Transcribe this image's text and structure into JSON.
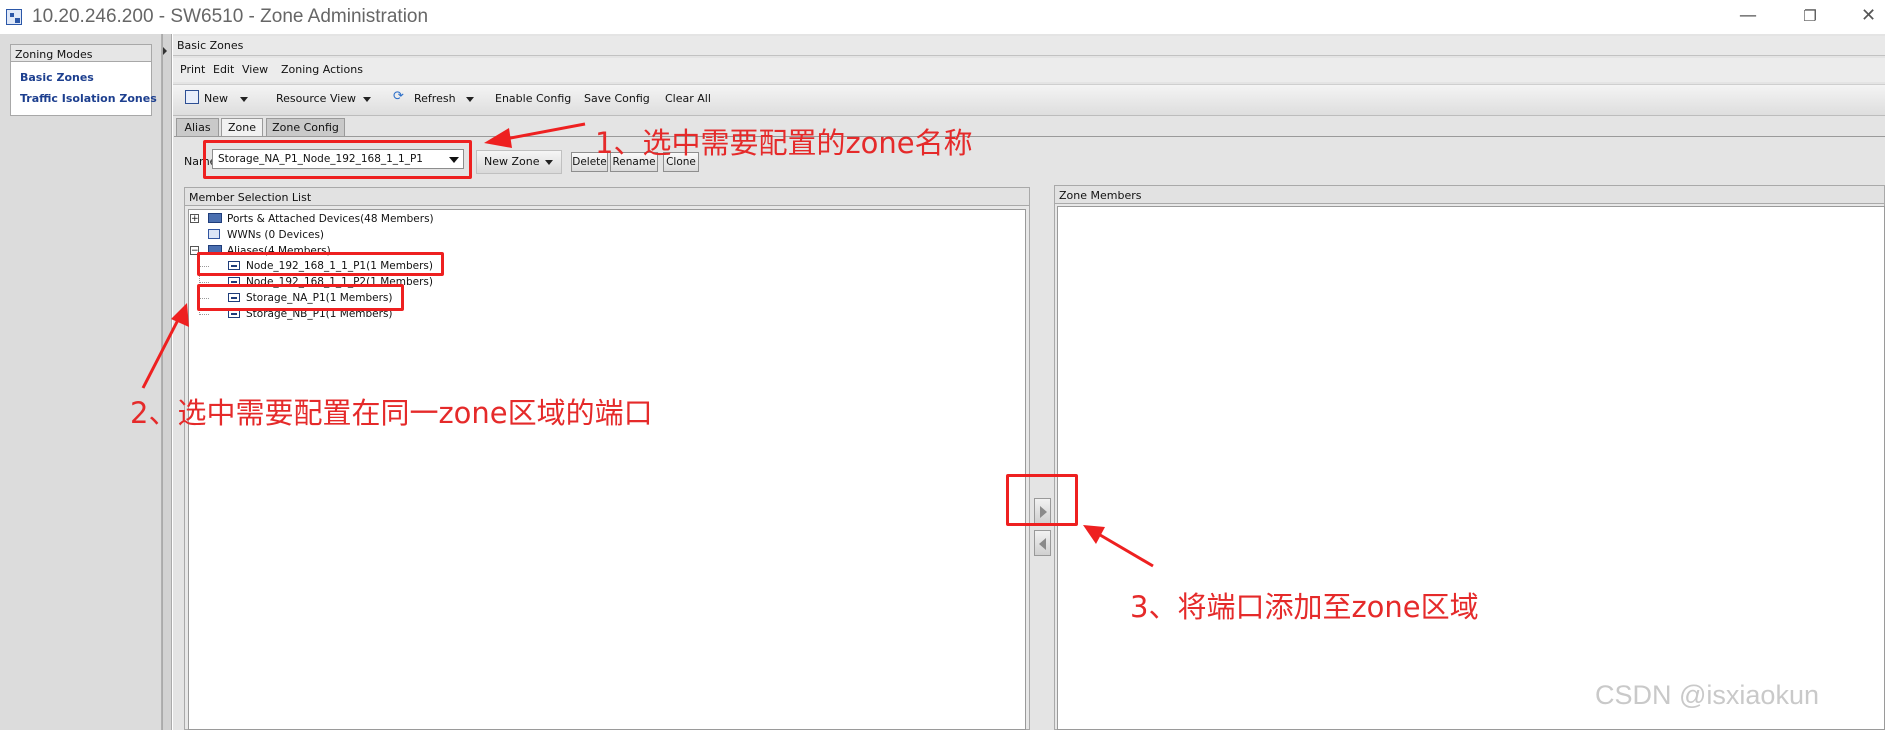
{
  "window": {
    "title": "10.20.246.200 - SW6510 - Zone Administration",
    "minimize_glyph": "—",
    "restore_glyph": "❐",
    "close_glyph": "✕"
  },
  "zoning_modes": {
    "header": "Zoning Modes",
    "items": [
      "Basic Zones",
      "Traffic Isolation Zones"
    ]
  },
  "main": {
    "header": "Basic Zones",
    "menu": [
      "Print",
      "Edit",
      "View",
      "Zoning Actions"
    ],
    "toolbar": {
      "new": "New",
      "resource_view": "Resource View",
      "refresh": "Refresh",
      "enable_config": "Enable Config",
      "save_config": "Save Config",
      "clear_all": "Clear All"
    },
    "tabs": [
      "Alias",
      "Zone",
      "Zone Config"
    ],
    "active_tab": "Zone",
    "name_label": "Name",
    "name_value": "Storage_NA_P1_Node_192_168_1_1_P1",
    "buttons": {
      "new_zone": "New Zone",
      "delete": "Delete",
      "rename": "Rename",
      "clone": "Clone"
    }
  },
  "member_selection": {
    "header": "Member Selection List",
    "tree": {
      "ports": "Ports & Attached Devices(48 Members)",
      "wwns": "WWNs (0 Devices)",
      "aliases": "Aliases(4 Members)",
      "alias_items": [
        "Node_192_168_1_1_P1(1 Members)",
        "Node_192_168_1_1_P2(1 Members)",
        "Storage_NA_P1(1 Members)",
        "Storage_NB_P1(1 Members)"
      ]
    }
  },
  "zone_members": {
    "header": "Zone Members"
  },
  "annotations": {
    "step1": "1、选中需要配置的zone名称",
    "step2": "2、选中需要配置在同一zone区域的端口",
    "step3": "3、将端口添加至zone区域",
    "accent_color": "#ee2020"
  },
  "watermark": "CSDN @isxiaokun"
}
